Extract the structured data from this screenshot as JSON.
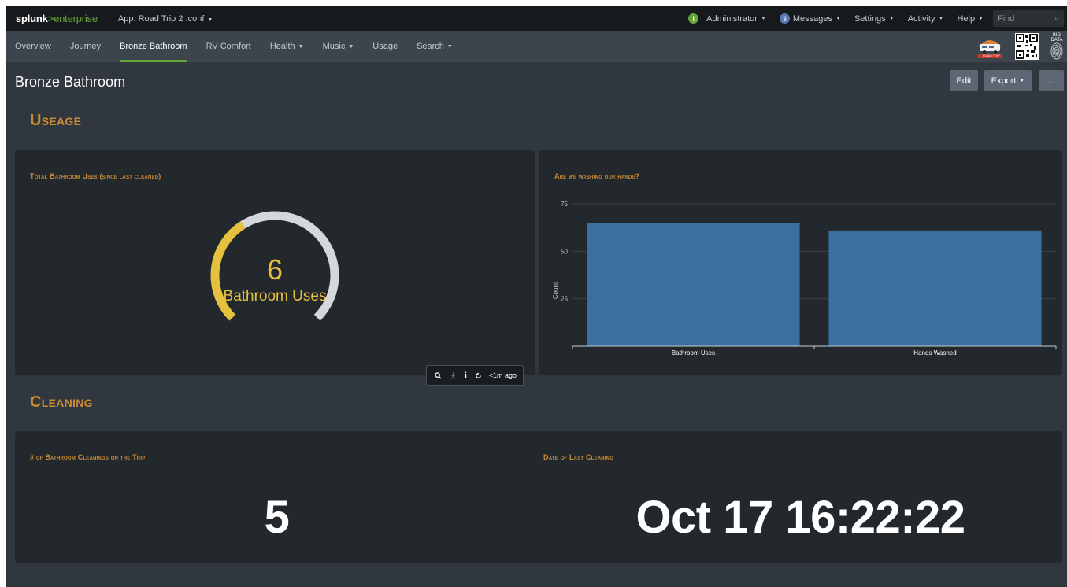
{
  "appbar": {
    "logo_main": "splunk",
    "logo_gt": ">",
    "logo_sub": "enterprise",
    "app_menu": "App: Road Trip 2 .conf",
    "menus": {
      "administrator": "Administrator",
      "messages_count": "3",
      "messages": "Messages",
      "settings": "Settings",
      "activity": "Activity",
      "help": "Help"
    },
    "find_placeholder": "Find"
  },
  "nav": {
    "items": [
      {
        "label": "Overview"
      },
      {
        "label": "Journey"
      },
      {
        "label": "Bronze Bathroom",
        "active": true
      },
      {
        "label": "RV Comfort"
      },
      {
        "label": "Health",
        "dropdown": true
      },
      {
        "label": "Music",
        "dropdown": true
      },
      {
        "label": "Usage"
      },
      {
        "label": "Search",
        "dropdown": true
      }
    ],
    "logo_text": "ROAD TRIP",
    "logo_big": "BIG DATA"
  },
  "dashboard": {
    "title": "Bronze Bathroom",
    "edit_label": "Edit",
    "export_label": "Export",
    "more_label": "..."
  },
  "sections": {
    "useage": "Useage",
    "cleaning": "Cleaning"
  },
  "panels": {
    "total_uses": {
      "title": "Total Bathroom Uses (since last cleaned)",
      "value": "6",
      "unit": "Bathroom Uses",
      "gauge_fraction": 0.38,
      "gauge_fill_color": "#e6c13e",
      "gauge_track_color": "#d4d8dc"
    },
    "washing": {
      "title": "Are we washing our hands?"
    },
    "cleanings": {
      "title": "# of Bathroom Cleanings on the Trip",
      "value": "5"
    },
    "last_cleaning": {
      "title": "Date of Last Cleaning",
      "value": "Oct 17 16:22:22"
    }
  },
  "toolbar": {
    "time_ago": "<1m ago"
  },
  "chart_data": {
    "type": "bar",
    "categories": [
      "Bathroom Uses",
      "Hands Washed"
    ],
    "values": [
      65,
      61
    ],
    "ylabel": "Count",
    "ylim": [
      0,
      75
    ],
    "yticks": [
      25,
      50,
      75
    ],
    "bar_color": "#3b6f9e",
    "grid": true
  }
}
